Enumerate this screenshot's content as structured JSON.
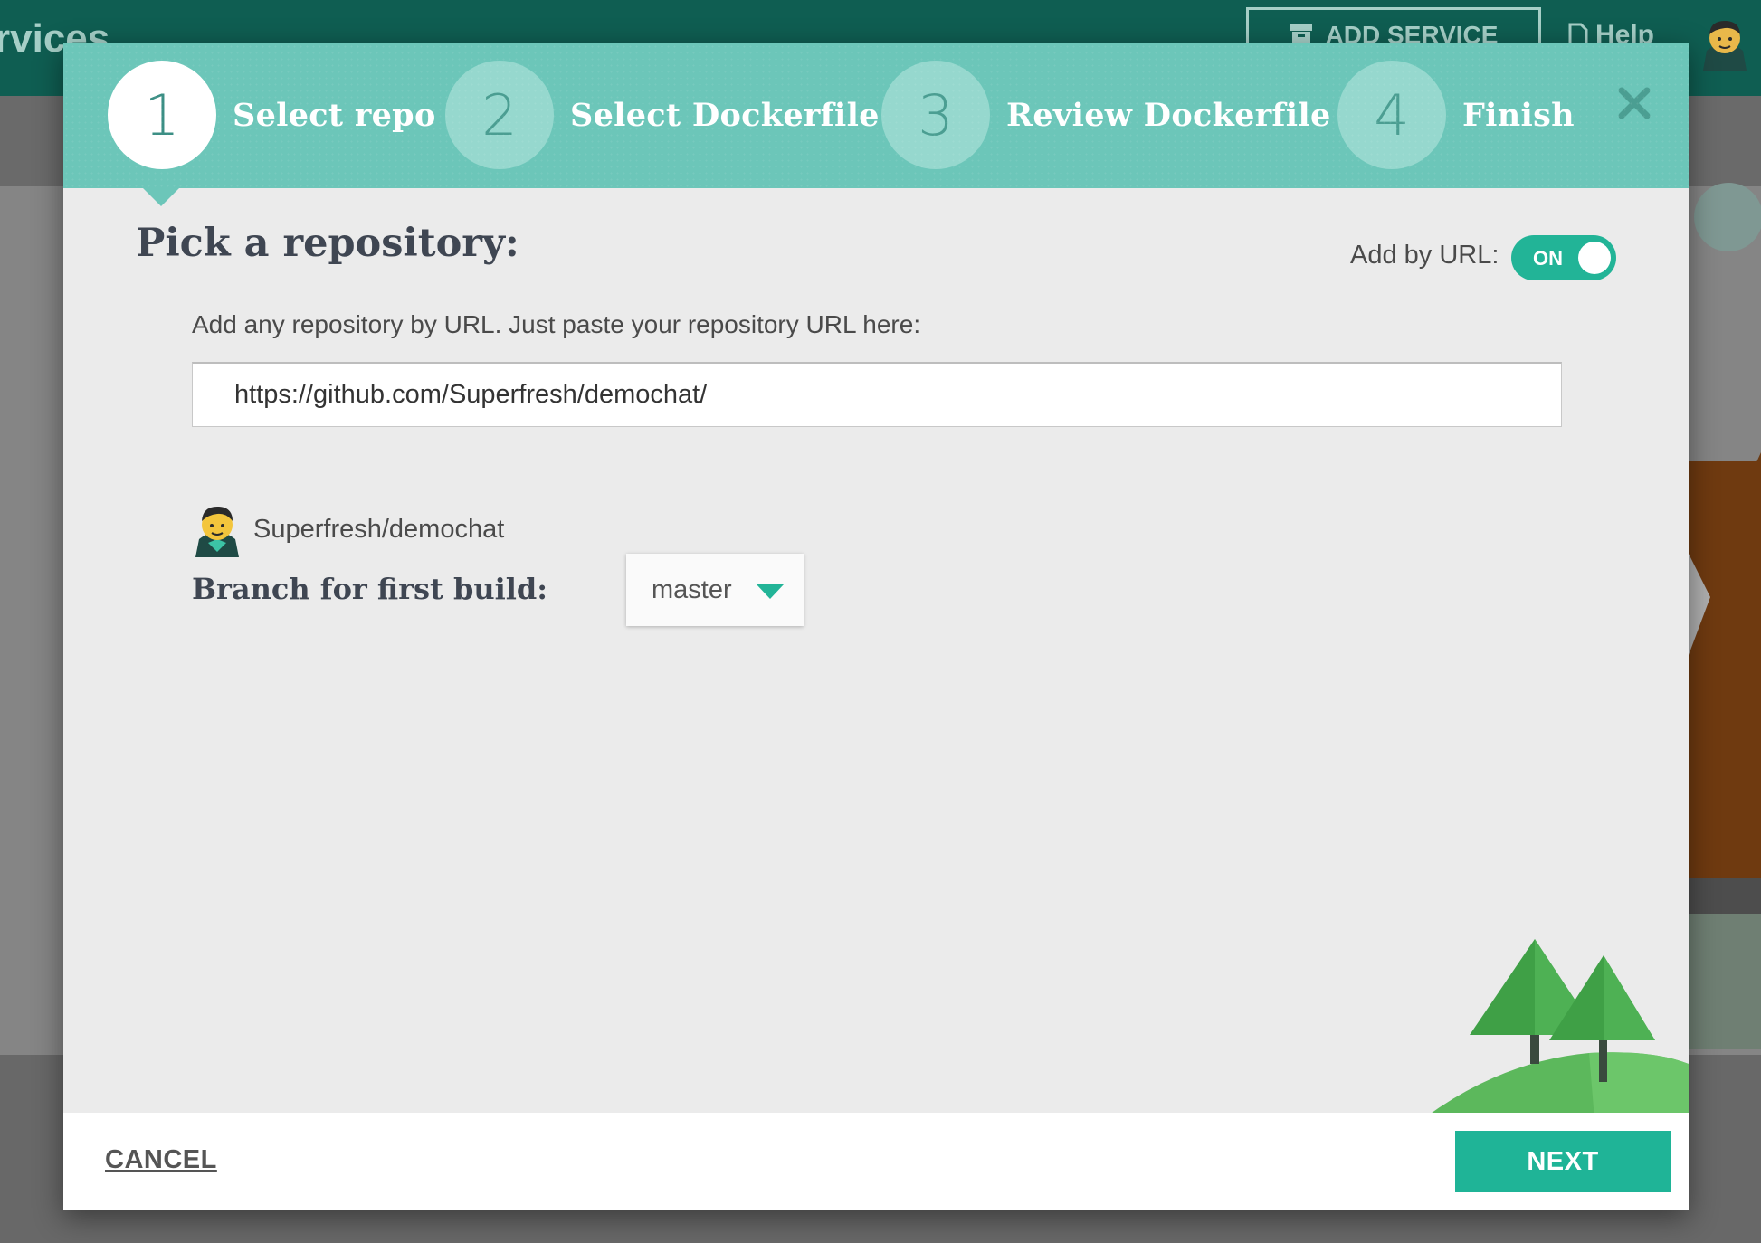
{
  "background": {
    "title_fragment": "rvices",
    "add_service_label": "ADD SERVICE",
    "help_label": "Help"
  },
  "wizard": {
    "steps": [
      {
        "number": "1",
        "label": "Select repo",
        "active": true
      },
      {
        "number": "2",
        "label": "Select Dockerfile",
        "active": false
      },
      {
        "number": "3",
        "label": "Review Dockerfile",
        "active": false
      },
      {
        "number": "4",
        "label": "Finish",
        "active": false
      }
    ],
    "close_icon": "close-icon"
  },
  "content": {
    "title": "Pick a repository:",
    "add_by_url_label": "Add by URL:",
    "toggle_state": "ON",
    "hint": "Add any repository by URL. Just paste your repository URL here:",
    "url_value": "https://github.com/Superfresh/demochat/",
    "repo_name": "Superfresh/demochat",
    "branch_label": "Branch for first build:",
    "branch_value": "master"
  },
  "footer": {
    "cancel_label": "CANCEL",
    "next_label": "NEXT"
  },
  "colors": {
    "header_teal": "#0f5e52",
    "stepper_teal": "#6cc6b9",
    "accent_green": "#1fb497"
  }
}
